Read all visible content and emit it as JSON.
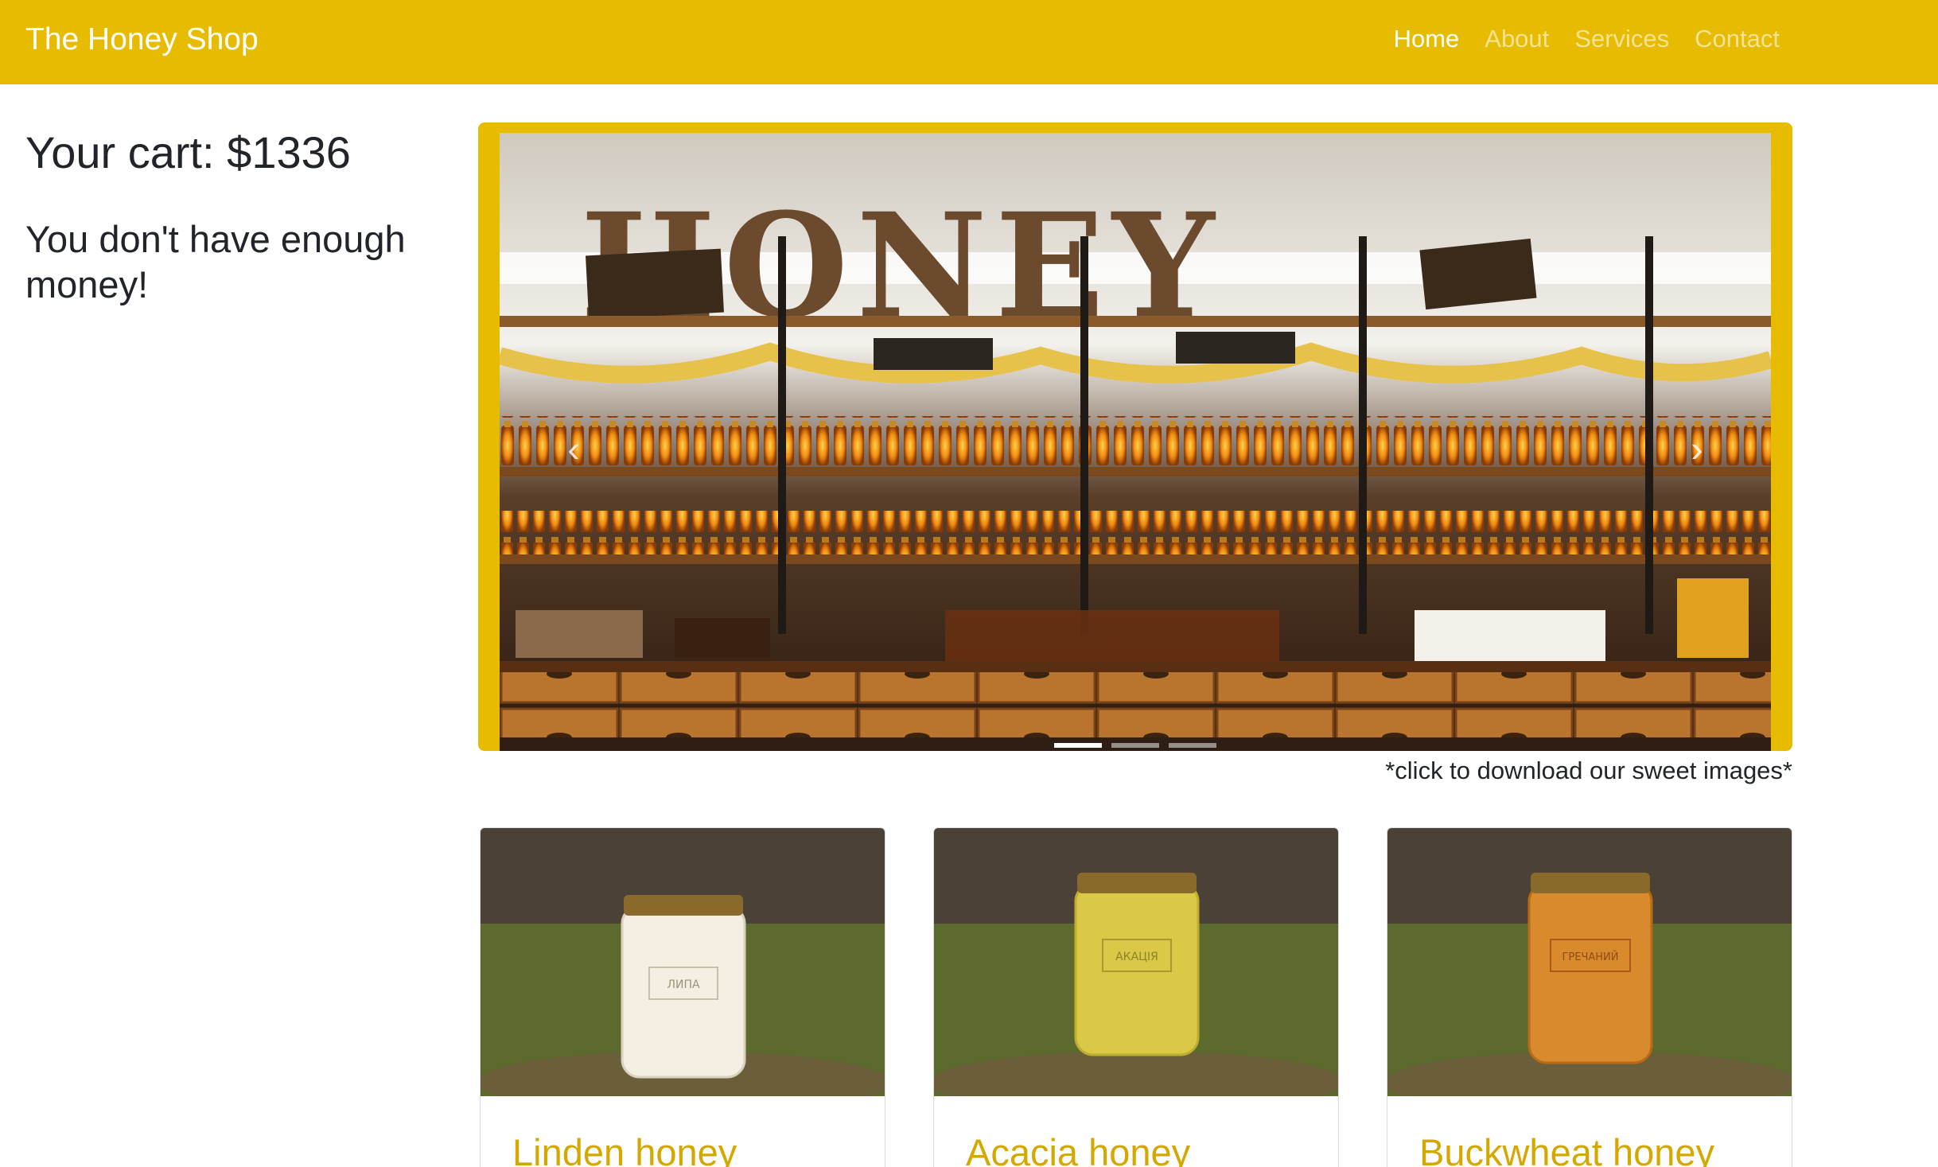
{
  "navbar": {
    "brand": "The Honey Shop",
    "links": [
      "Home",
      "About",
      "Services",
      "Contact"
    ],
    "active": "Home"
  },
  "cart": {
    "label": "Your cart: $1336",
    "message": "You don't have enough money!"
  },
  "carousel": {
    "image_sign": "HONEY",
    "caption": "*click to download our sweet images*",
    "slides": 3,
    "active_slide": 1
  },
  "products": [
    {
      "title": "Linden honey",
      "jar_label": "ЛИПА",
      "jar_color": "#f4efe2"
    },
    {
      "title": "Acacia honey",
      "jar_label": "АКАЦІЯ",
      "jar_color": "#d9c947"
    },
    {
      "title": "Buckwheat honey",
      "jar_label": "ГРЕЧАНИЙ",
      "jar_color": "#d98a2c"
    }
  ],
  "colors": {
    "brand": "#e6bb00",
    "title_link": "#d4a800"
  }
}
